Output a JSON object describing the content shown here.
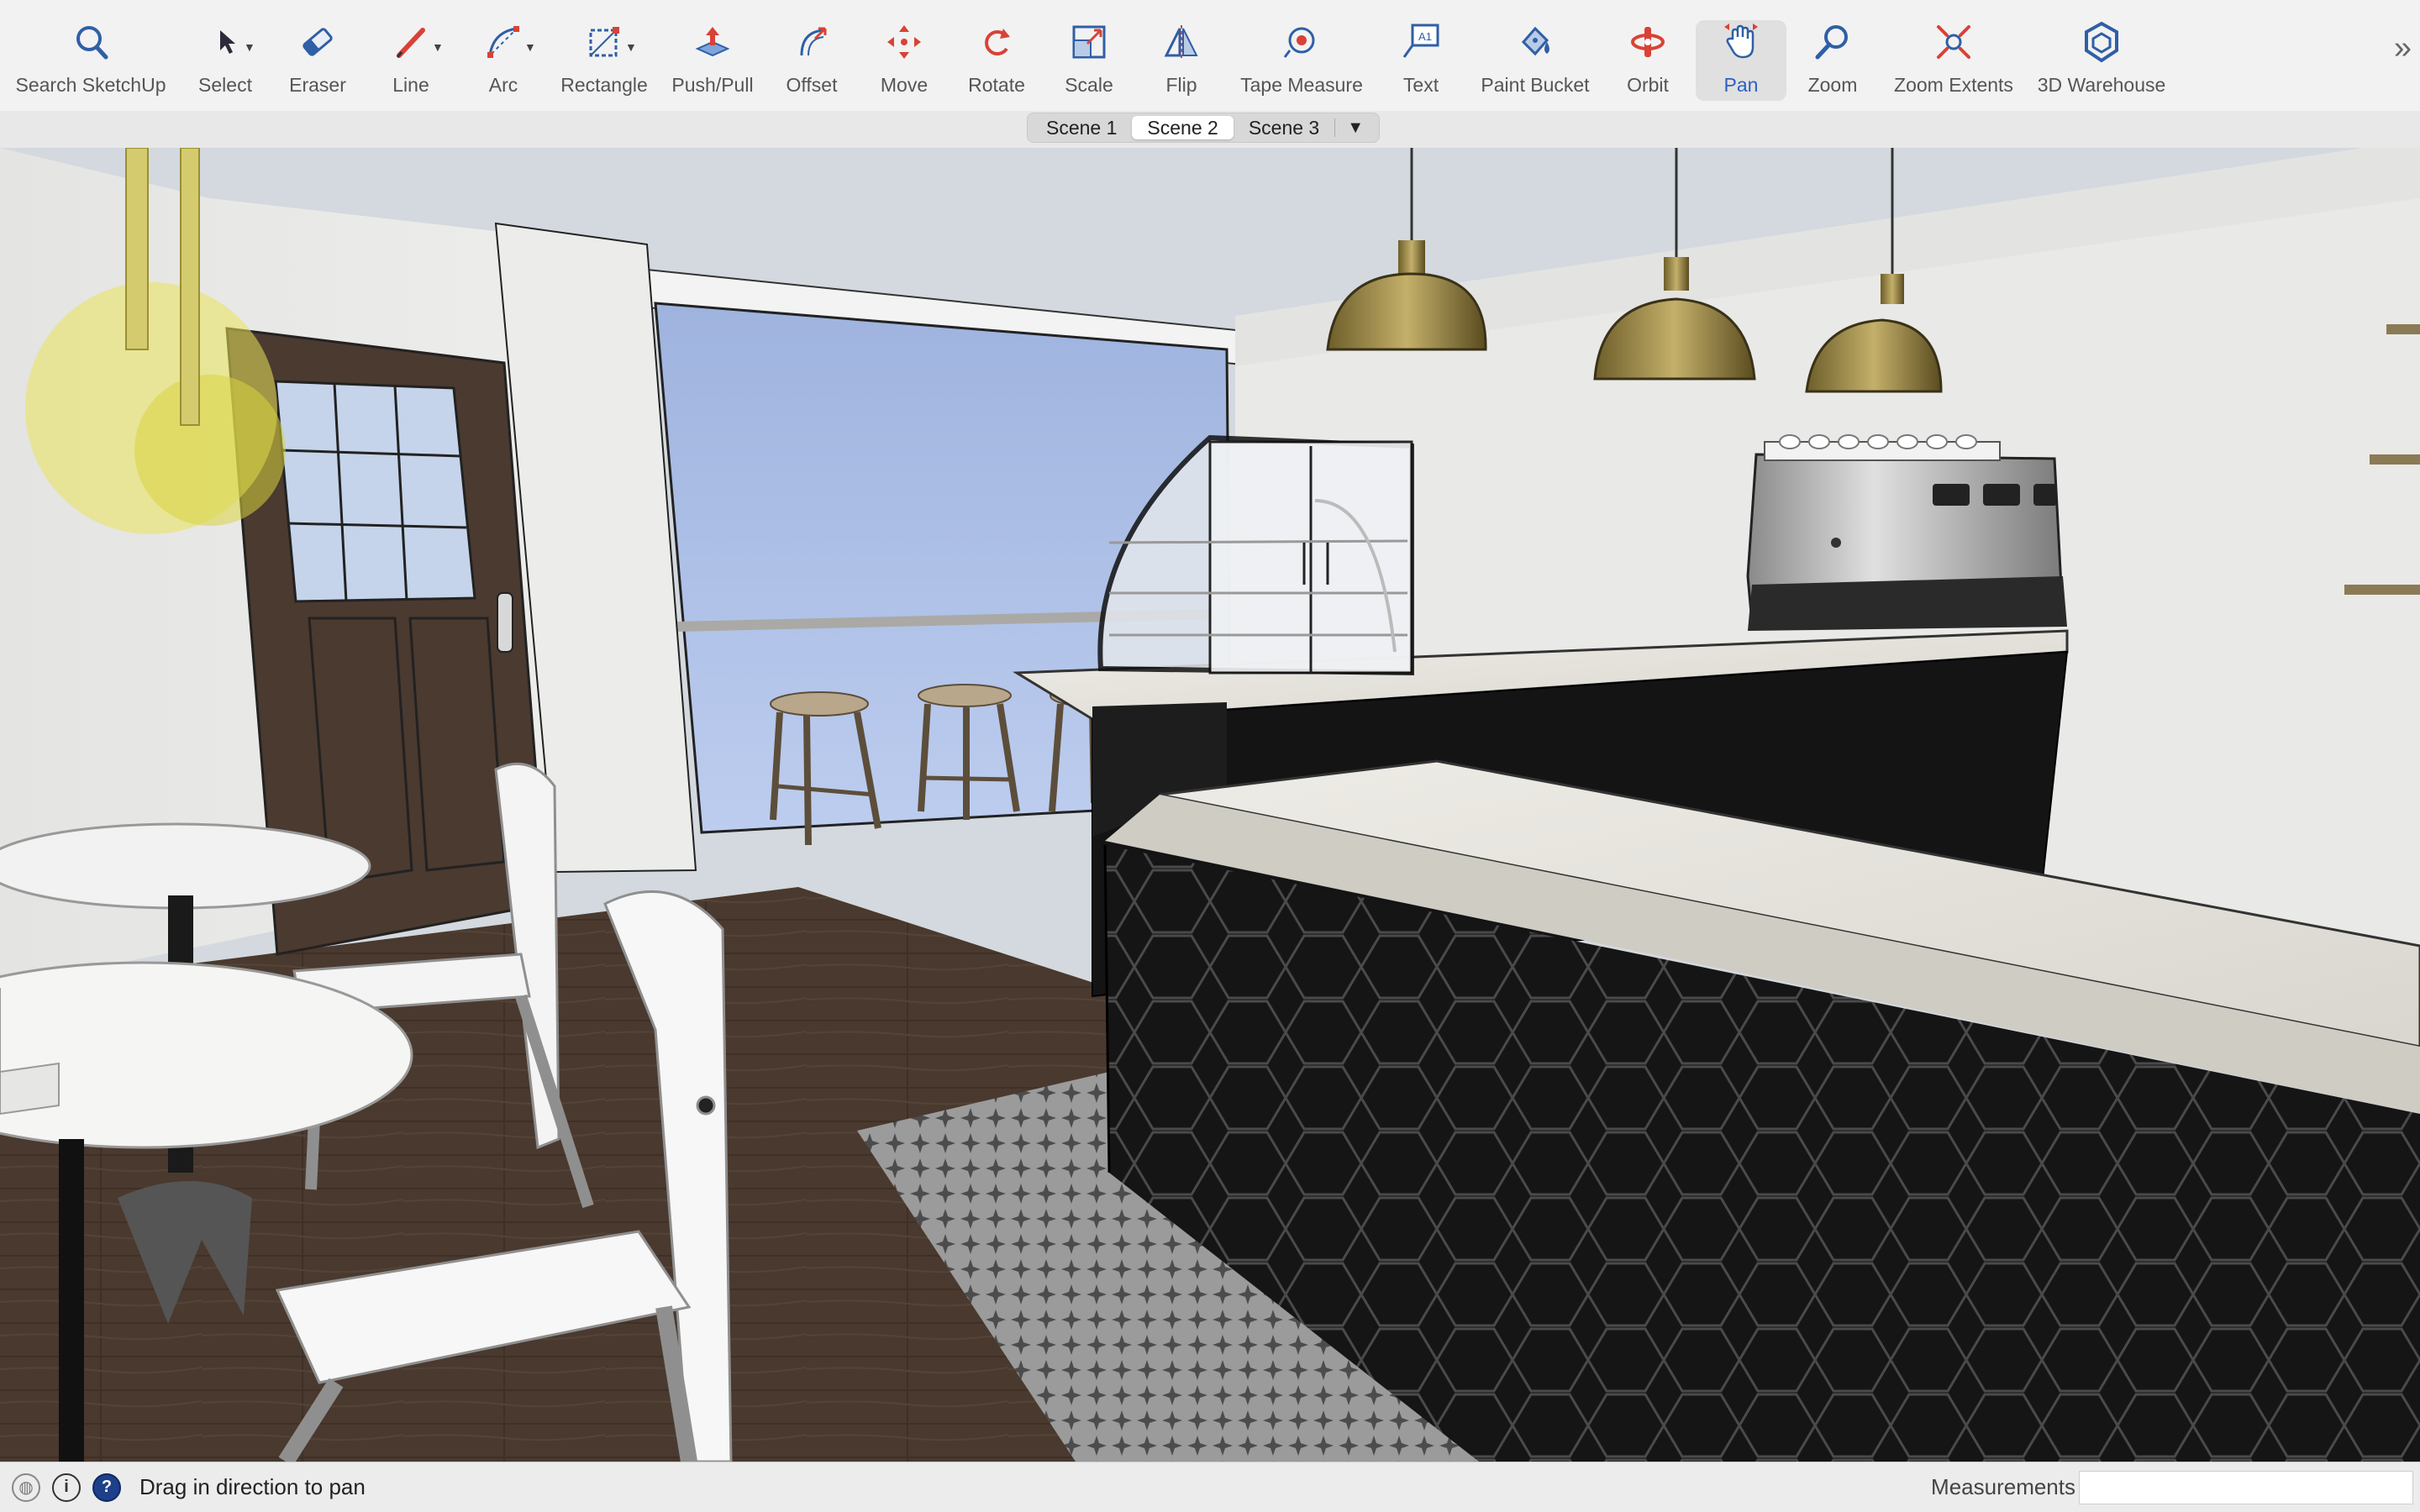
{
  "toolbar": {
    "tools": [
      {
        "id": "search",
        "label": "Search SketchUp",
        "icon": "search-icon"
      },
      {
        "id": "select",
        "label": "Select",
        "icon": "select-arrow-icon"
      },
      {
        "id": "eraser",
        "label": "Eraser",
        "icon": "eraser-icon"
      },
      {
        "id": "line",
        "label": "Line",
        "icon": "pencil-icon"
      },
      {
        "id": "arc",
        "label": "Arc",
        "icon": "arc-icon"
      },
      {
        "id": "rectangle",
        "label": "Rectangle",
        "icon": "rectangle-icon"
      },
      {
        "id": "pushpull",
        "label": "Push/Pull",
        "icon": "push-pull-icon"
      },
      {
        "id": "offset",
        "label": "Offset",
        "icon": "offset-icon"
      },
      {
        "id": "move",
        "label": "Move",
        "icon": "move-icon"
      },
      {
        "id": "rotate",
        "label": "Rotate",
        "icon": "rotate-icon"
      },
      {
        "id": "scale",
        "label": "Scale",
        "icon": "scale-icon"
      },
      {
        "id": "flip",
        "label": "Flip",
        "icon": "flip-icon"
      },
      {
        "id": "tapemeasure",
        "label": "Tape Measure",
        "icon": "tape-measure-icon"
      },
      {
        "id": "text",
        "label": "Text",
        "icon": "text-icon"
      },
      {
        "id": "paintbucket",
        "label": "Paint Bucket",
        "icon": "paint-bucket-icon"
      },
      {
        "id": "orbit",
        "label": "Orbit",
        "icon": "orbit-icon"
      },
      {
        "id": "pan",
        "label": "Pan",
        "icon": "pan-hand-icon",
        "active": true
      },
      {
        "id": "zoom",
        "label": "Zoom",
        "icon": "zoom-icon"
      },
      {
        "id": "zoomextents",
        "label": "Zoom Extents",
        "icon": "zoom-extents-icon"
      },
      {
        "id": "warehouse",
        "label": "3D Warehouse",
        "icon": "warehouse-icon"
      }
    ],
    "icon_glyphs": {
      "text_glyph": "A1"
    }
  },
  "scenes": {
    "tabs": [
      "Scene 1",
      "Scene 2",
      "Scene 3"
    ],
    "active_index": 1,
    "more_glyph": "▼"
  },
  "statusbar": {
    "hint": "Drag in direction to pan",
    "measurements_label": "Measurements",
    "measurements_value": "",
    "help_glyph": "?",
    "info_glyph": "i"
  },
  "colors": {
    "accent": "#2d5fc7",
    "icon_red": "#d94236",
    "icon_blue": "#2f5fa6",
    "toolbar_bg": "#f2f2f2"
  }
}
